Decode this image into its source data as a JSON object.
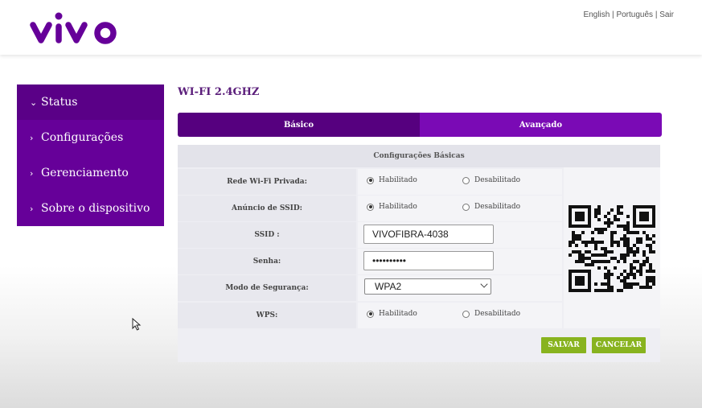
{
  "brand": {
    "logo_text": "vivo",
    "color": "#660099"
  },
  "header_links": {
    "english": "English",
    "portugues": "Português",
    "sair": "Sair",
    "separator": "|"
  },
  "sidebar": {
    "items": [
      {
        "label": "Status",
        "icon": "chevron-down-icon",
        "active": true
      },
      {
        "label": "Configurações",
        "icon": "chevron-right-icon",
        "active": false
      },
      {
        "label": "Gerenciamento",
        "icon": "chevron-right-icon",
        "active": false
      },
      {
        "label": "Sobre o dispositivo",
        "icon": "chevron-right-icon",
        "active": false
      }
    ]
  },
  "page": {
    "title": "WI-FI 2.4GHZ",
    "tabs": [
      {
        "label": "Básico",
        "active": true
      },
      {
        "label": "Avançado",
        "active": false
      }
    ],
    "panel_header": "Configurações Básicas",
    "rows": {
      "private_network": {
        "label": "Rede Wi-Fi Privada:",
        "opt_on": "Habilitado",
        "opt_off": "Desabilitado",
        "selected": "Habilitado"
      },
      "ssid_broadcast": {
        "label": "Anúncio de SSID:",
        "opt_on": "Habilitado",
        "opt_off": "Desabilitado",
        "selected": "Habilitado"
      },
      "ssid": {
        "label": "SSID :",
        "value": "VIVOFIBRA-4038"
      },
      "password": {
        "label": "Senha:",
        "value": "••••••••••"
      },
      "security_mode": {
        "label": "Modo de Segurança:",
        "value": "WPA2"
      },
      "wps": {
        "label": "WPS:",
        "opt_on": "Habilitado",
        "opt_off": "Desabilitado",
        "selected": "Habilitado"
      }
    },
    "buttons": {
      "save": "SALVAR",
      "cancel": "CANCELAR"
    },
    "accent_button_color": "#88b31f"
  }
}
